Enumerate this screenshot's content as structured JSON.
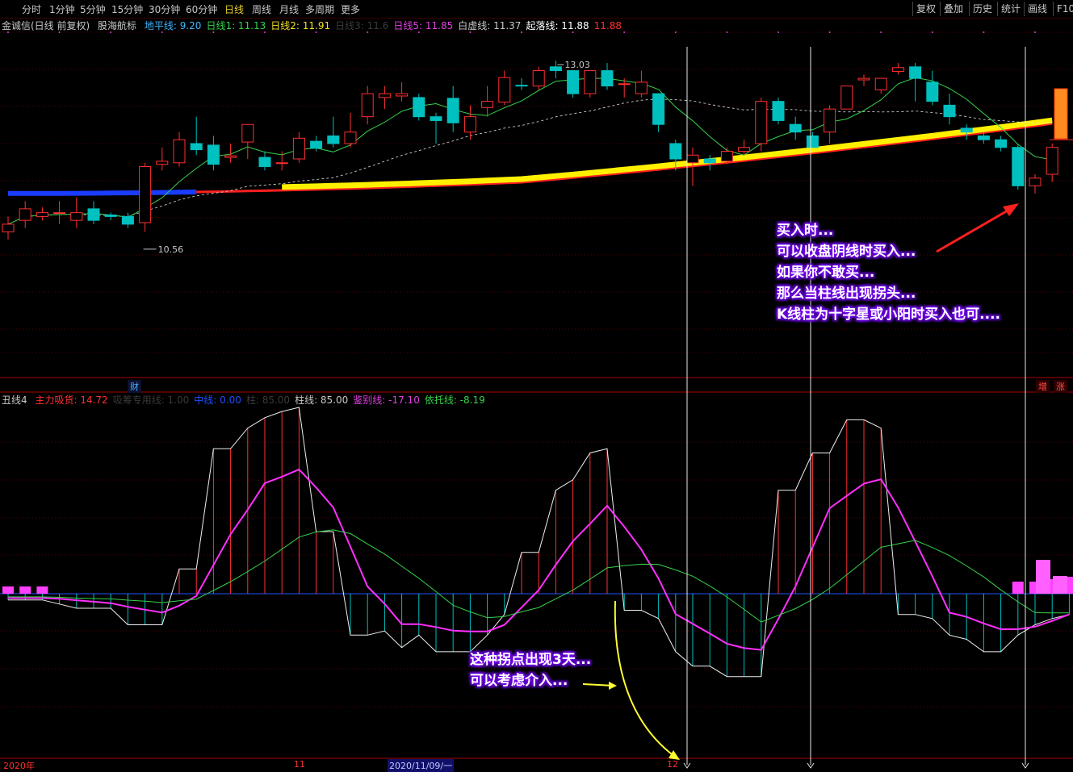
{
  "toolbar": {
    "periods": [
      "分时",
      "1分钟",
      "5分钟",
      "15分钟",
      "30分钟",
      "60分钟",
      "日线",
      "周线",
      "月线",
      "多周期",
      "更多"
    ],
    "active_period": "日线",
    "right_buttons": [
      "复权",
      "叠加",
      "历史",
      "统计",
      "画线",
      "F10"
    ]
  },
  "main_legend": {
    "stock": "金诚信(日线 前复权)",
    "indicator": "股海航标",
    "items": [
      {
        "text": "地平线: 9.20",
        "color": "#3fb6ff"
      },
      {
        "text": "日线1: 11.13",
        "color": "#36d24a"
      },
      {
        "text": "日线2: 11.91",
        "color": "#f0e020"
      },
      {
        "text": "日线3: 11.6",
        "color": "#3a3a3a"
      },
      {
        "text": "日线5: 11.85",
        "color": "#e040e0"
      },
      {
        "text": "白虚线: 11.37",
        "color": "#c8c8c8"
      },
      {
        "text": "起落线: 11.88",
        "color": "#ffffff"
      },
      {
        "text": "11.88",
        "color": "#ff3030"
      }
    ]
  },
  "sub_legend": {
    "indicator": "丑线4",
    "items": [
      {
        "text": "主力吸货: 14.72",
        "color": "#ff3030"
      },
      {
        "text": "吸筹专用线: 1.00",
        "color": "#3a3a3a"
      },
      {
        "text": "中线: 0.00",
        "color": "#2050ff"
      },
      {
        "text": "柱: 85.00",
        "color": "#3a3a3a"
      },
      {
        "text": "柱线: 85.00",
        "color": "#c8c8c8"
      },
      {
        "text": "鉴别线: -17.10",
        "color": "#e040e0"
      },
      {
        "text": "依托线: -8.19",
        "color": "#36d24a"
      }
    ]
  },
  "price_labels": {
    "high": "13.03",
    "low": "10.56"
  },
  "tags": {
    "cai": "财",
    "zeng": "增",
    "zhang": "涨"
  },
  "annotation_main": [
    "买入时...",
    "可以收盘阴线时买入...",
    "如果你不敢买...",
    "那么当柱线出现拐头...",
    "K线柱为十字星或小阳时买入也可...."
  ],
  "annotation_sub": [
    "这种拐点出现3天...",
    "可以考虑介入..."
  ],
  "dates": [
    "2020年",
    "11",
    "2020/11/09/一",
    "12"
  ],
  "colors": {
    "up": "#ff3030",
    "down": "#00c0c0",
    "bg": "#000000",
    "grid": "#5a0000"
  },
  "chart_data": {
    "type": "candlestick",
    "candles": [
      {
        "o": 10.8,
        "c": 10.9,
        "h": 11.0,
        "l": 10.7
      },
      {
        "o": 10.95,
        "c": 11.1,
        "h": 11.2,
        "l": 10.85
      },
      {
        "o": 11.0,
        "c": 11.05,
        "h": 11.12,
        "l": 10.95
      },
      {
        "o": 11.05,
        "c": 11.05,
        "h": 11.2,
        "l": 10.9
      },
      {
        "o": 10.95,
        "c": 11.05,
        "h": 11.25,
        "l": 10.85
      },
      {
        "o": 11.1,
        "c": 10.95,
        "h": 11.2,
        "l": 10.9
      },
      {
        "o": 11.02,
        "c": 11.0,
        "h": 11.05,
        "l": 10.95
      },
      {
        "o": 11.0,
        "c": 10.9,
        "h": 11.05,
        "l": 10.85
      },
      {
        "o": 10.92,
        "c": 11.65,
        "h": 11.7,
        "l": 10.8
      },
      {
        "o": 11.68,
        "c": 11.72,
        "h": 11.9,
        "l": 11.6
      },
      {
        "o": 11.7,
        "c": 12.0,
        "h": 12.1,
        "l": 11.65
      },
      {
        "o": 11.95,
        "c": 11.87,
        "h": 12.3,
        "l": 11.8
      },
      {
        "o": 11.93,
        "c": 11.68,
        "h": 12.05,
        "l": 11.6
      },
      {
        "o": 11.77,
        "c": 11.79,
        "h": 11.95,
        "l": 11.7
      },
      {
        "o": 11.97,
        "c": 12.2,
        "h": 12.2,
        "l": 11.75
      },
      {
        "o": 11.77,
        "c": 11.65,
        "h": 11.85,
        "l": 11.6
      },
      {
        "o": 11.69,
        "c": 11.7,
        "h": 11.85,
        "l": 11.6
      },
      {
        "o": 11.75,
        "c": 12.02,
        "h": 12.1,
        "l": 11.7
      },
      {
        "o": 11.98,
        "c": 11.89,
        "h": 12.05,
        "l": 11.85
      },
      {
        "o": 12.05,
        "c": 11.95,
        "h": 12.3,
        "l": 11.9
      },
      {
        "o": 11.95,
        "c": 12.1,
        "h": 12.35,
        "l": 11.9
      },
      {
        "o": 12.3,
        "c": 12.6,
        "h": 12.7,
        "l": 12.2
      },
      {
        "o": 12.55,
        "c": 12.6,
        "h": 12.7,
        "l": 12.4
      },
      {
        "o": 12.57,
        "c": 12.6,
        "h": 12.75,
        "l": 12.5
      },
      {
        "o": 12.55,
        "c": 12.3,
        "h": 12.6,
        "l": 12.25
      },
      {
        "o": 12.3,
        "c": 12.25,
        "h": 12.35,
        "l": 11.95
      },
      {
        "o": 12.54,
        "c": 12.22,
        "h": 12.7,
        "l": 12.1
      },
      {
        "o": 12.1,
        "c": 12.3,
        "h": 12.45,
        "l": 12.0
      },
      {
        "o": 12.42,
        "c": 12.5,
        "h": 12.7,
        "l": 12.3
      },
      {
        "o": 12.49,
        "c": 12.81,
        "h": 12.9,
        "l": 12.45
      },
      {
        "o": 12.71,
        "c": 12.7,
        "h": 12.8,
        "l": 12.65
      },
      {
        "o": 12.7,
        "c": 12.9,
        "h": 12.95,
        "l": 12.65
      },
      {
        "o": 12.95,
        "c": 12.9,
        "h": 13.03,
        "l": 12.8
      },
      {
        "o": 12.9,
        "c": 12.6,
        "h": 12.9,
        "l": 12.55
      },
      {
        "o": 12.6,
        "c": 12.9,
        "h": 12.9,
        "l": 12.55
      },
      {
        "o": 12.9,
        "c": 12.7,
        "h": 13.0,
        "l": 12.65
      },
      {
        "o": 12.72,
        "c": 12.73,
        "h": 12.8,
        "l": 12.55
      },
      {
        "o": 12.6,
        "c": 12.75,
        "h": 12.9,
        "l": 12.55
      },
      {
        "o": 12.6,
        "c": 12.2,
        "h": 12.6,
        "l": 12.1
      },
      {
        "o": 11.95,
        "c": 11.75,
        "h": 12.0,
        "l": 11.6
      },
      {
        "o": 11.7,
        "c": 11.8,
        "h": 11.9,
        "l": 11.4
      },
      {
        "o": 11.75,
        "c": 11.7,
        "h": 11.8,
        "l": 11.6
      },
      {
        "o": 11.72,
        "c": 11.85,
        "h": 11.9,
        "l": 11.7
      },
      {
        "o": 11.85,
        "c": 11.9,
        "h": 12.0,
        "l": 11.8
      },
      {
        "o": 11.95,
        "c": 12.5,
        "h": 12.55,
        "l": 11.85
      },
      {
        "o": 12.5,
        "c": 12.25,
        "h": 12.55,
        "l": 12.2
      },
      {
        "o": 12.2,
        "c": 12.1,
        "h": 12.3,
        "l": 12.0
      },
      {
        "o": 12.05,
        "c": 11.9,
        "h": 12.1,
        "l": 11.9
      },
      {
        "o": 12.1,
        "c": 12.4,
        "h": 12.45,
        "l": 11.95
      },
      {
        "o": 12.4,
        "c": 12.7,
        "h": 12.7,
        "l": 12.4
      },
      {
        "o": 12.78,
        "c": 12.8,
        "h": 12.85,
        "l": 12.7
      },
      {
        "o": 12.65,
        "c": 12.8,
        "h": 12.8,
        "l": 12.6
      },
      {
        "o": 12.89,
        "c": 12.94,
        "h": 13.0,
        "l": 12.85
      },
      {
        "o": 12.95,
        "c": 12.8,
        "h": 13.0,
        "l": 12.5
      },
      {
        "o": 12.75,
        "c": 12.5,
        "h": 12.9,
        "l": 12.45
      },
      {
        "o": 12.45,
        "c": 12.3,
        "h": 12.6,
        "l": 12.2
      },
      {
        "o": 12.15,
        "c": 12.1,
        "h": 12.2,
        "l": 12.0
      },
      {
        "o": 12.05,
        "c": 12.0,
        "h": 12.1,
        "l": 11.95
      },
      {
        "o": 12.0,
        "c": 11.9,
        "h": 12.05,
        "l": 11.85
      },
      {
        "o": 11.9,
        "c": 11.4,
        "h": 11.95,
        "l": 11.35
      },
      {
        "o": 11.4,
        "c": 11.5,
        "h": 11.55,
        "l": 11.3
      },
      {
        "o": 11.55,
        "c": 11.9,
        "h": 11.95,
        "l": 11.45
      }
    ],
    "sub": {
      "ylim": [
        -8,
        93
      ],
      "bars": [
        -3,
        -3,
        -3,
        -5,
        -7,
        -7,
        -7,
        -15,
        -15,
        -15,
        12,
        12,
        70,
        70,
        80,
        85,
        88,
        90,
        30,
        30,
        -20,
        -20,
        -18,
        -26,
        -20,
        -28,
        -28,
        -28,
        -20,
        -10,
        20,
        20,
        50,
        55,
        68,
        70,
        -8,
        -8,
        -12,
        -28,
        -35,
        -35,
        -40,
        -40,
        -40,
        50,
        50,
        68,
        68,
        84,
        84,
        80,
        -10,
        -10,
        -12,
        -20,
        -22,
        -28,
        -28,
        -20,
        -15,
        -12,
        -10
      ],
      "hist": [
        3,
        3,
        3,
        3,
        3,
        3,
        2,
        1,
        1,
        2,
        3,
        3,
        4,
        4,
        5,
        5,
        6,
        6,
        5,
        4,
        3,
        3,
        3,
        3,
        3,
        3,
        3,
        3,
        3,
        4,
        4,
        4,
        5,
        5,
        6,
        6,
        6,
        6,
        5,
        4,
        3,
        3,
        3,
        3,
        3,
        4,
        5,
        5,
        6,
        6,
        7,
        7,
        6,
        5,
        5,
        5,
        5,
        5,
        5,
        5,
        5,
        6,
        7
      ]
    }
  }
}
